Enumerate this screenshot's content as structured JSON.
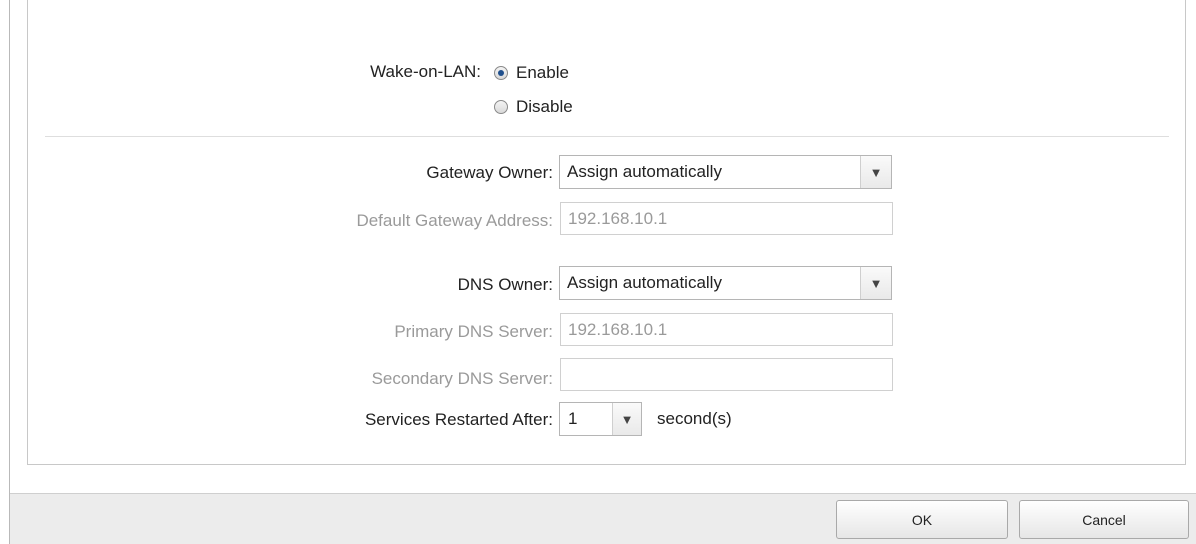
{
  "wake_on_lan": {
    "label": "Wake-on-LAN:",
    "options": [
      {
        "label": "Enable",
        "selected": true
      },
      {
        "label": "Disable",
        "selected": false
      }
    ]
  },
  "gateway_owner": {
    "label": "Gateway Owner:",
    "value": "Assign automatically"
  },
  "default_gateway": {
    "label": "Default Gateway Address:",
    "value": "192.168.10.1"
  },
  "dns_owner": {
    "label": "DNS Owner:",
    "value": "Assign automatically"
  },
  "primary_dns": {
    "label": "Primary DNS Server:",
    "value": "192.168.10.1"
  },
  "secondary_dns": {
    "label": "Secondary DNS Server:",
    "value": ""
  },
  "services_restart": {
    "label": "Services Restarted After:",
    "value": "1",
    "unit": "second(s)"
  },
  "footer": {
    "ok_label": "OK",
    "cancel_label": "Cancel"
  },
  "icons": {
    "dropdown": "chevron-down-icon",
    "radio": "radio-icon"
  }
}
